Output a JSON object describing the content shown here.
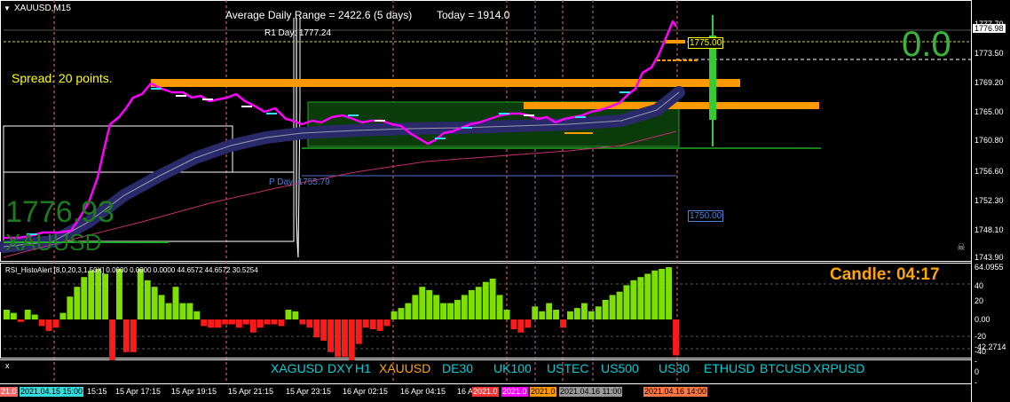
{
  "colors": {
    "background": "#000000",
    "price_line": "#ff00ff",
    "band": "#2a2a6a",
    "orange": "#ff9900",
    "green_big": "#3cb43c",
    "candle": "#33cc33",
    "bull_bar": "#7fe000",
    "bear_bar": "#ff1a1a",
    "cyan_text": "#00d0d8",
    "yellow_text": "#ffff00",
    "gold_text": "#ffa500"
  },
  "header": {
    "menu_icon": "triangle-down-icon",
    "symbol_tf": "XAUUSD,M15",
    "adr_text": "Average Daily Range = 2422.6 (5 days)",
    "today_text": "Today = 1914.0"
  },
  "main": {
    "r1_label": "R1 Day: 1777.24",
    "pday_label": "P Day: 1755.79",
    "spread_text": "Spread: 20 points.",
    "big_price": "1776.93",
    "big_symbol": "XAUUSD",
    "big_change": "0.0",
    "level_1775": "1775.00",
    "level_1750": "1750.00",
    "price_axis": [
      "1777.70",
      "1773.50",
      "1769.20",
      "1765.00",
      "1760.80",
      "1756.60",
      "1752.30",
      "1748.10",
      "1743.90"
    ],
    "current_price": "1776.98",
    "skull_icon": "skull-icon"
  },
  "indicator": {
    "title": "RSI_HistoAlert [8,0,20,3,1,50X] 0.0000 0.0000 0.0000 44.6572 44.6572 30.5254",
    "candle_timer": "Candle:  04:17",
    "axis": [
      "64.0955",
      "40",
      "20",
      "0.00",
      "-20",
      "-40",
      "-42.2714"
    ],
    "bars": [
      12,
      8,
      -3,
      12,
      6,
      -8,
      -14,
      -10,
      8,
      28,
      40,
      52,
      60,
      62,
      56,
      -50,
      62,
      -40,
      -40,
      62,
      48,
      40,
      30,
      20,
      40,
      20,
      20,
      10,
      -8,
      -10,
      -10,
      -6,
      -6,
      -10,
      -6,
      -16,
      -10,
      -6,
      -6,
      -8,
      12,
      10,
      -6,
      -10,
      -22,
      -26,
      -40,
      -46,
      -46,
      -50,
      -30,
      -10,
      -12,
      -14,
      -8,
      10,
      14,
      20,
      30,
      40,
      36,
      30,
      20,
      20,
      24,
      30,
      36,
      40,
      46,
      50,
      30,
      12,
      -12,
      -16,
      -10,
      16,
      10,
      20,
      12,
      -10,
      10,
      14,
      20,
      10,
      16,
      24,
      30,
      34,
      42,
      48,
      52,
      56,
      60,
      62,
      64,
      -44
    ]
  },
  "footer": {
    "close_x": "x",
    "symbols": [
      "XAGUSD",
      "DXY",
      "H1",
      "XAUUSD",
      "DE30",
      "UK100",
      "USTEC",
      "US500",
      "US30",
      "ETHUSD",
      "BTCUSD",
      "XRPUSD"
    ],
    "active_symbol": "XAUUSD",
    "time_labels": [
      "15 Apr 17:15",
      "15 Apr 19:15",
      "15 Apr 21:15",
      "15 Apr 23:15",
      "16 Apr 02:15",
      "16 Apr 04:15",
      "16 A"
    ],
    "tick_time_labels": [
      "21.0",
      "2021.04.15 15:00",
      "15:15",
      "2021.0",
      "2021.0",
      "2021.0",
      "2021.04.16 11:00",
      "2021.04.16 14:00"
    ],
    "right_ticks": [
      "-",
      "0",
      "-"
    ]
  }
}
